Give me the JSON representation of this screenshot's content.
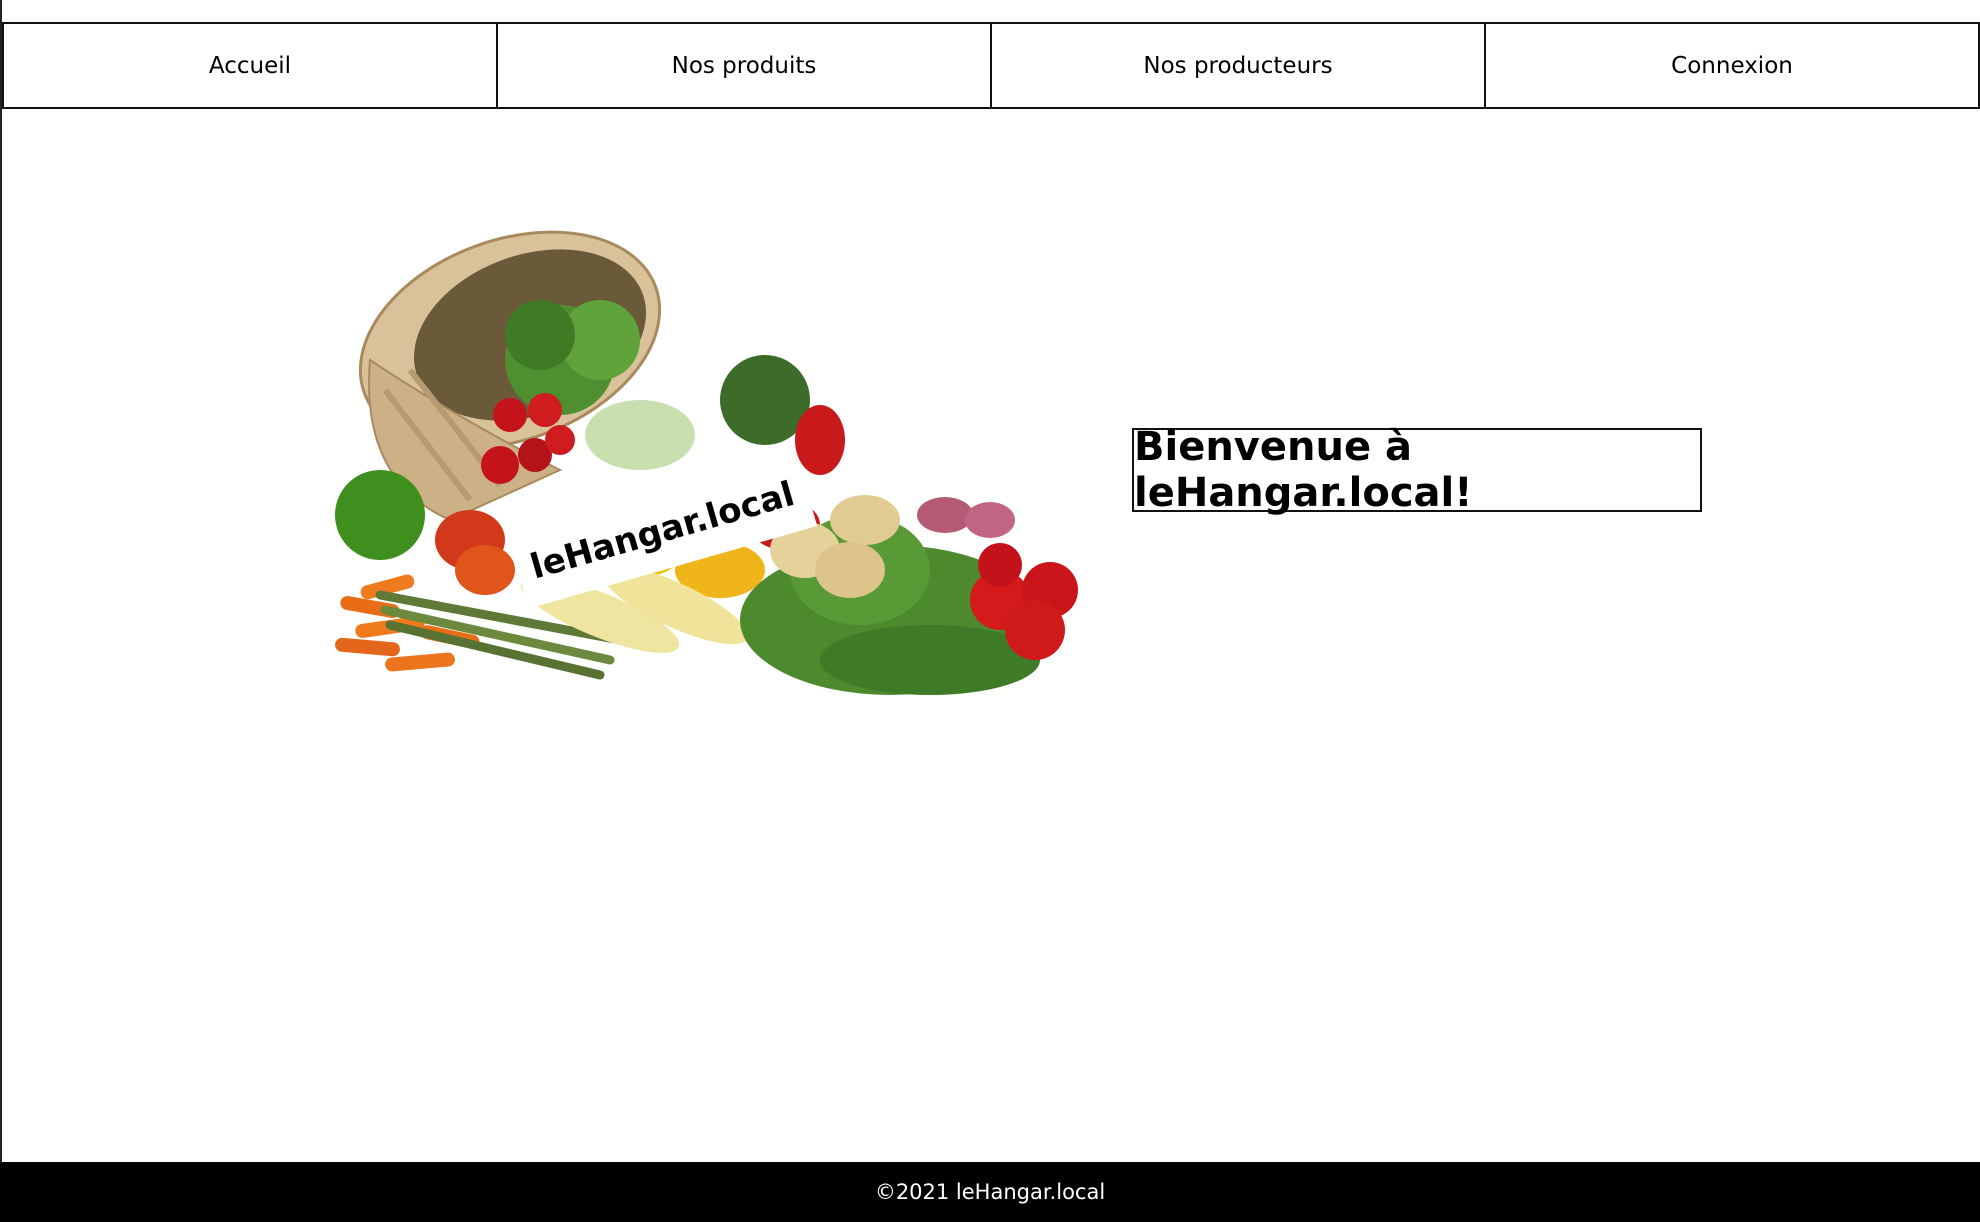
{
  "nav": {
    "items": [
      {
        "label": "Accueil"
      },
      {
        "label": "Nos produits"
      },
      {
        "label": "Nos producteurs"
      },
      {
        "label": "Connexion"
      }
    ]
  },
  "hero": {
    "logo_text": "leHangar.local"
  },
  "welcome": {
    "title": "Bienvenue à leHangar.local!"
  },
  "footer": {
    "text": "©2021 leHangar.local"
  },
  "colors": {
    "border": "#111111",
    "footer_bg": "#000000",
    "footer_text": "#ffffff",
    "background": "#ffffff"
  }
}
